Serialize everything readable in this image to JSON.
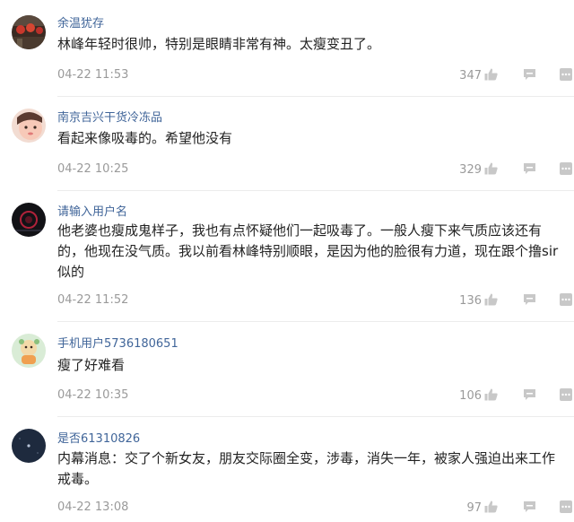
{
  "comments": [
    {
      "username": "余温犹存",
      "text": "林峰年轻时很帅，特别是眼睛非常有神。太瘦变丑了。",
      "time": "04-22 11:53",
      "likes": "347",
      "avatar_icon": "avatar-red-lanterns-icon"
    },
    {
      "username": "南京吉兴干货冷冻品",
      "text": "看起来像吸毒的。希望他没有",
      "time": "04-22 10:25",
      "likes": "329",
      "avatar_icon": "avatar-child-face-icon"
    },
    {
      "username": "请输入用户名",
      "text": "他老婆也瘦成鬼样子，我也有点怀疑他们一起吸毒了。一般人瘦下来气质应该还有的，他现在没气质。我以前看林峰特别顺眼，是因为他的脸很有力道，现在跟个撸sir似的",
      "time": "04-22 11:52",
      "likes": "136",
      "avatar_icon": "avatar-dark-neon-icon"
    },
    {
      "username": "手机用户5736180651",
      "text": "瘦了好难看",
      "time": "04-22 10:35",
      "likes": "106",
      "avatar_icon": "avatar-cartoon-icon"
    },
    {
      "username": "是否61310826",
      "text": "内幕消息：交了个新女友，朋友交际圈全变，涉毒，消失一年，被家人强迫出来工作戒毒。",
      "time": "04-22 13:08",
      "likes": "97",
      "avatar_icon": "avatar-night-sky-icon"
    }
  ],
  "colors": {
    "username": "#406599",
    "text": "#222222",
    "meta": "#9a9a9a"
  }
}
